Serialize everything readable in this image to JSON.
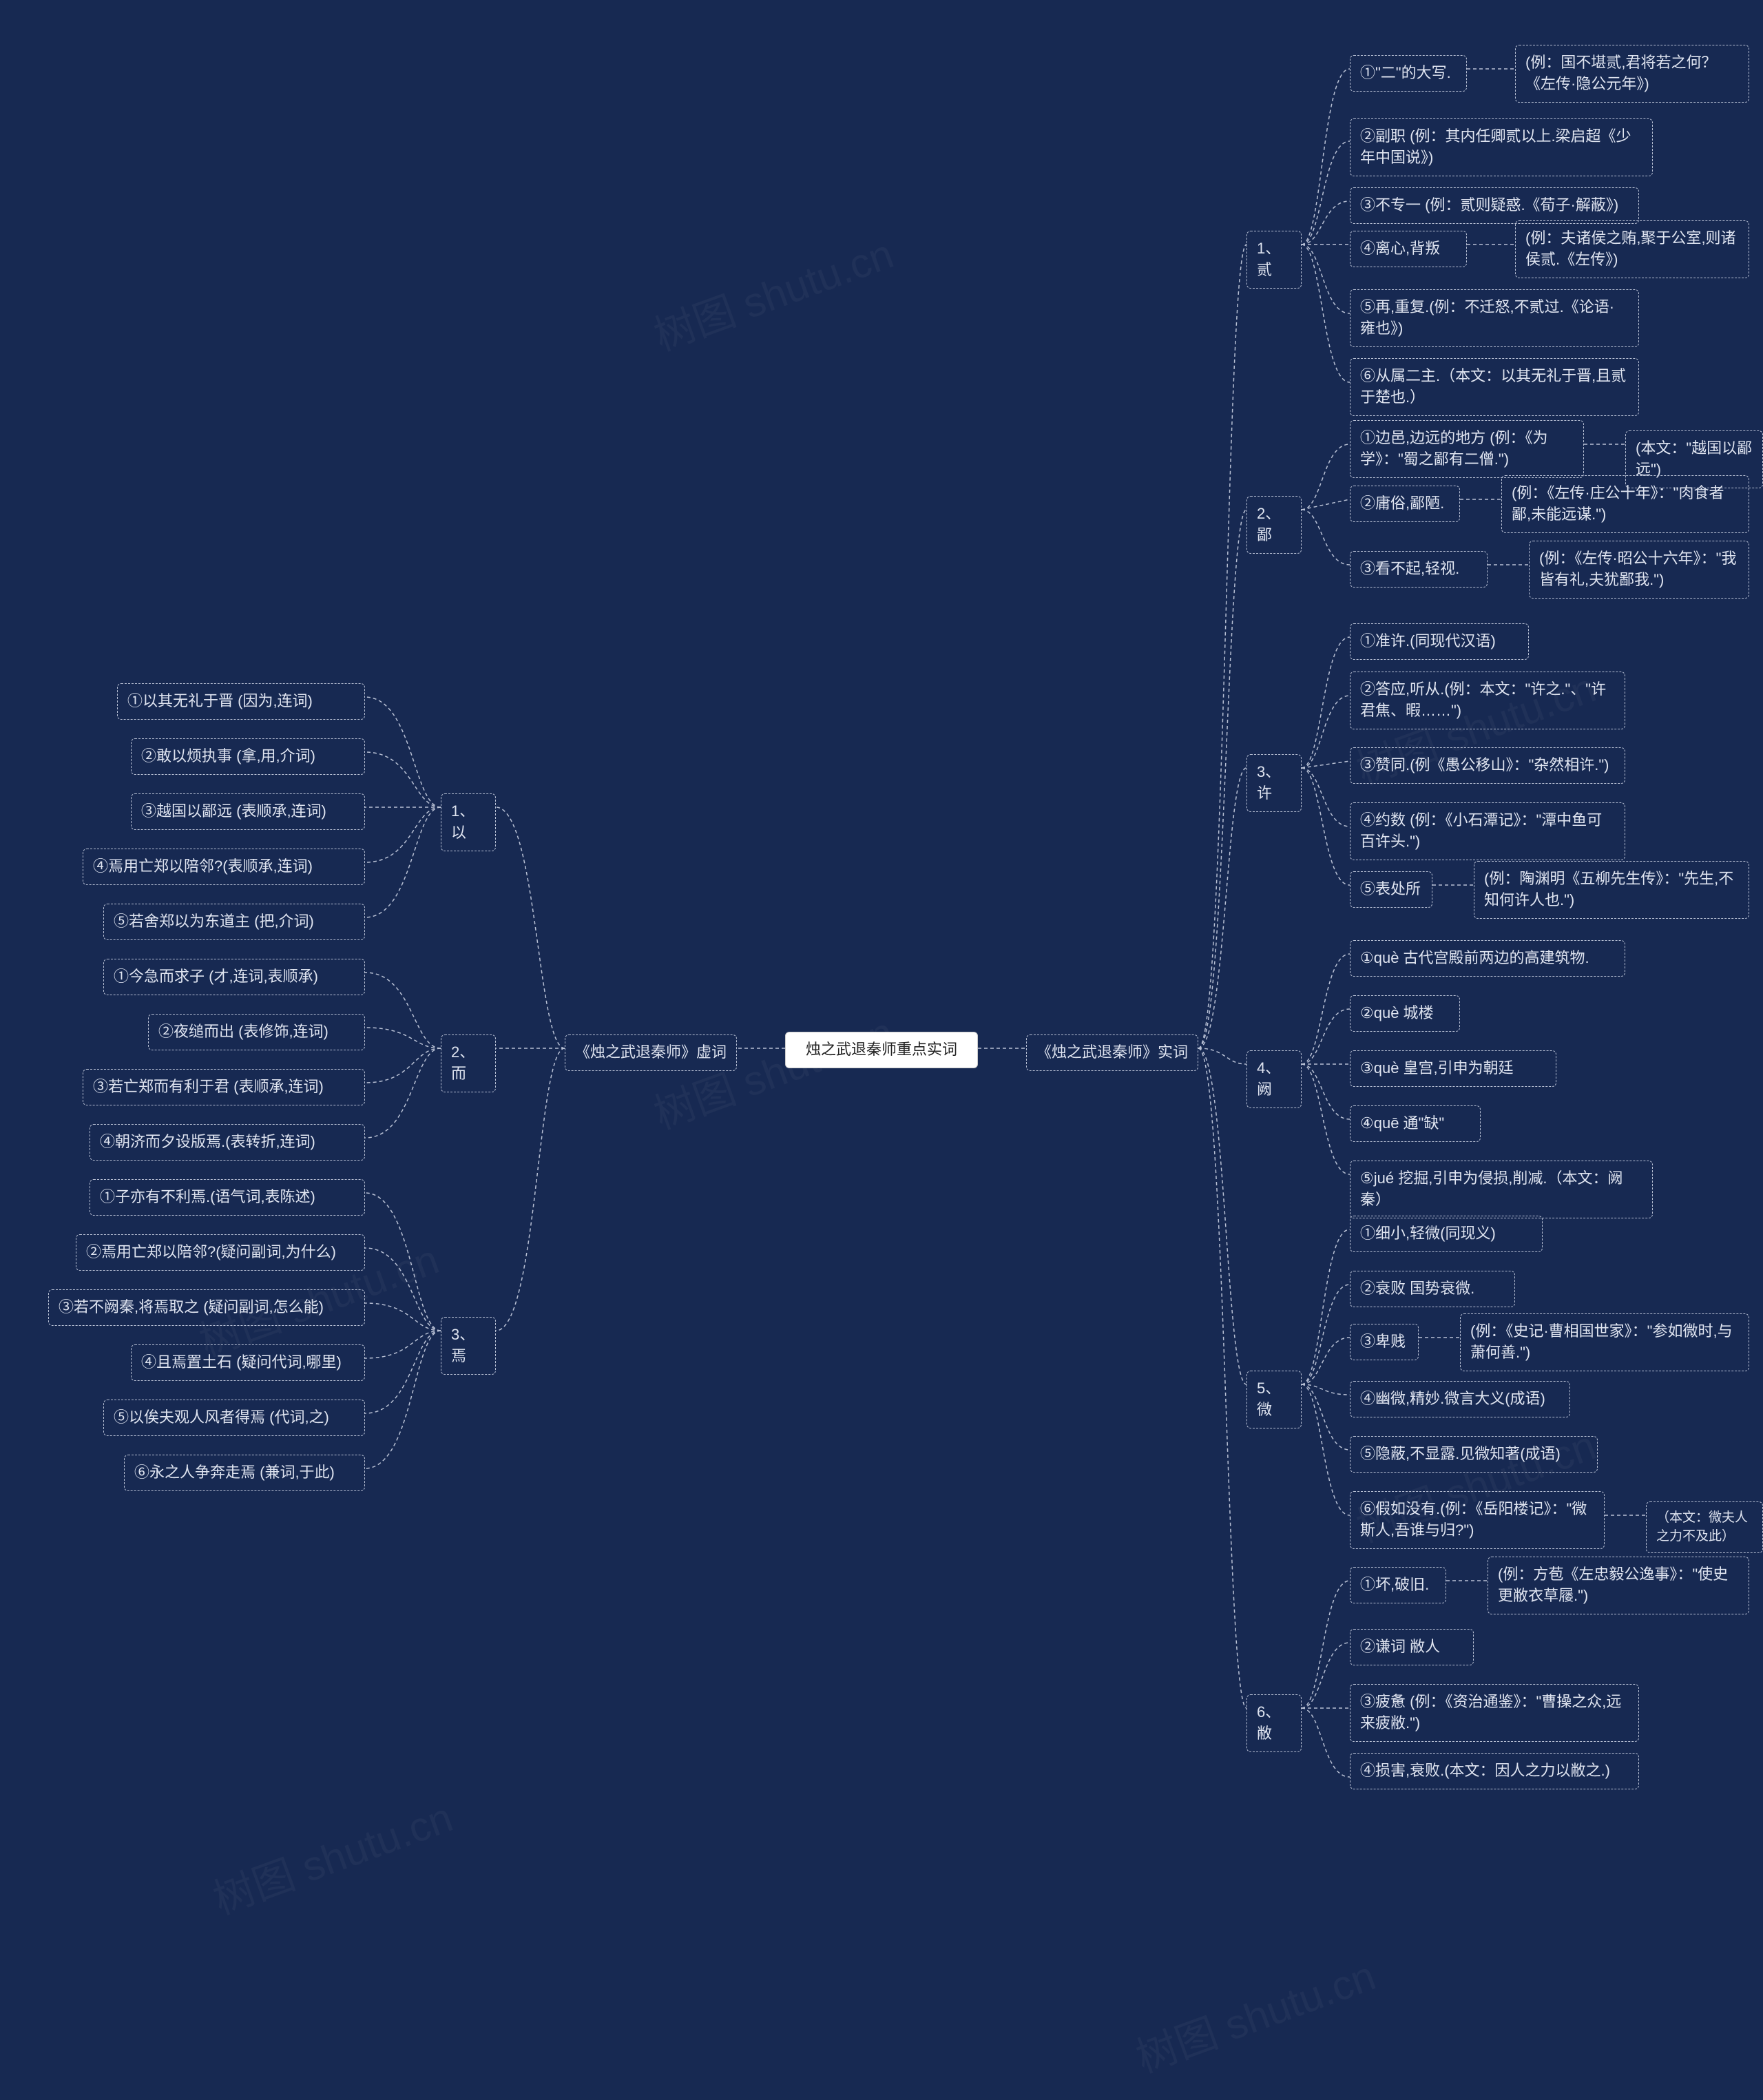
{
  "watermarks": [
    "树图 shutu.cn",
    "树图 shutu.cn",
    "树图 shutu.cn",
    "树图 shutu.cn",
    "树图 shutu.cn",
    "树图 shutu.cn",
    "树图 shutu.cn"
  ],
  "root": {
    "label": "烛之武退秦师重点实词"
  },
  "left": {
    "title": "《烛之武退秦师》虚词",
    "groups": [
      {
        "label": "1、以",
        "items": [
          "①以其无礼于晋 (因为,连词)",
          "②敢以烦执事 (拿,用,介词)",
          "③越国以鄙远 (表顺承,连词)",
          "④焉用亡郑以陪邻?(表顺承,连词)",
          "⑤若舍郑以为东道主 (把,介词)"
        ]
      },
      {
        "label": "2、而",
        "items": [
          "①今急而求子 (才,连词,表顺承)",
          "②夜缒而出 (表修饰,连词)",
          "③若亡郑而有利于君 (表顺承,连词)",
          "④朝济而夕设版焉.(表转折,连词)"
        ]
      },
      {
        "label": "3、焉",
        "items": [
          "①子亦有不利焉.(语气词,表陈述)",
          "②焉用亡郑以陪邻?(疑问副词,为什么)",
          "③若不阙秦,将焉取之 (疑问副词,怎么能)",
          "④且焉置土石 (疑问代词,哪里)",
          "⑤以俟夫观人风者得焉 (代词,之)",
          "⑥永之人争奔走焉 (兼词,于此)"
        ]
      }
    ]
  },
  "right": {
    "title": "《烛之武退秦师》实词",
    "groups": [
      {
        "label": "1、贰",
        "items": [
          {
            "text": "①\"二\"的大写.",
            "note": "(例：国不堪贰,君将若之何？《左传·隐公元年》)"
          },
          {
            "text": "②副职 (例：其内任卿贰以上.梁启超《少年中国说》)"
          },
          {
            "text": "③不专一 (例：贰则疑惑.《荀子·解蔽》)"
          },
          {
            "text": "④离心,背叛",
            "note": "(例：夫诸侯之贿,聚于公室,则诸侯贰.《左传》)"
          },
          {
            "text": "⑤再,重复.(例：不迁怒,不贰过.《论语·雍也》)"
          },
          {
            "text": "⑥从属二主.（本文：以其无礼于晋,且贰于楚也.）"
          }
        ]
      },
      {
        "label": "2、鄙",
        "items": [
          {
            "text": "①边邑,边远的地方 (例：《为学》：\"蜀之鄙有二僧.\")",
            "note": "(本文：\"越国以鄙远\")"
          },
          {
            "text": "②庸俗,鄙陋.",
            "note": "(例：《左传·庄公十年》：\"肉食者鄙,未能远谋.\")"
          },
          {
            "text": "③看不起,轻视.",
            "note": "(例：《左传·昭公十六年》：\"我皆有礼,夫犹鄙我.\")"
          }
        ]
      },
      {
        "label": "3、许",
        "items": [
          {
            "text": "①准许.(同现代汉语)"
          },
          {
            "text": "②答应,听从.(例：本文：\"许之.\"、\"许君焦、暇……\")"
          },
          {
            "text": "③赞同.(例《愚公移山》：\"杂然相许.\")"
          },
          {
            "text": "④约数 (例：《小石潭记》：\"潭中鱼可百许头.\")"
          },
          {
            "text": "⑤表处所",
            "note": "(例：陶渊明《五柳先生传》：\"先生,不知何许人也.\")"
          }
        ]
      },
      {
        "label": "4、阙",
        "items": [
          {
            "text": "①què 古代宫殿前两边的高建筑物."
          },
          {
            "text": "②què 城楼"
          },
          {
            "text": "③què 皇宫,引申为朝廷"
          },
          {
            "text": "④quē 通\"缺\""
          },
          {
            "text": "⑤jué 挖掘,引申为侵损,削减.（本文：阙秦）"
          }
        ]
      },
      {
        "label": "5、微",
        "items": [
          {
            "text": "①细小,轻微(同现义)"
          },
          {
            "text": "②衰败 国势衰微."
          },
          {
            "text": "③卑贱",
            "note": "(例：《史记·曹相国世家》：\"参如微时,与萧何善.\")"
          },
          {
            "text": "④幽微,精妙.微言大义(成语)"
          },
          {
            "text": "⑤隐蔽,不显露.见微知著(成语)"
          },
          {
            "text": "⑥假如没有.(例：《岳阳楼记》：\"微斯人,吾谁与归?\")",
            "note": "（本文：微夫人之力不及此）"
          }
        ]
      },
      {
        "label": "6、敝",
        "items": [
          {
            "text": "①坏,破旧.",
            "note": "(例：方苞《左忠毅公逸事》：\"使史更敝衣草屦.\")"
          },
          {
            "text": "②谦词 敝人"
          },
          {
            "text": "③疲惫 (例：《资治通鉴》：\"曹操之众,远来疲敝.\")"
          },
          {
            "text": "④损害,衰败.(本文：因人之力以敝之.)"
          }
        ]
      }
    ]
  }
}
